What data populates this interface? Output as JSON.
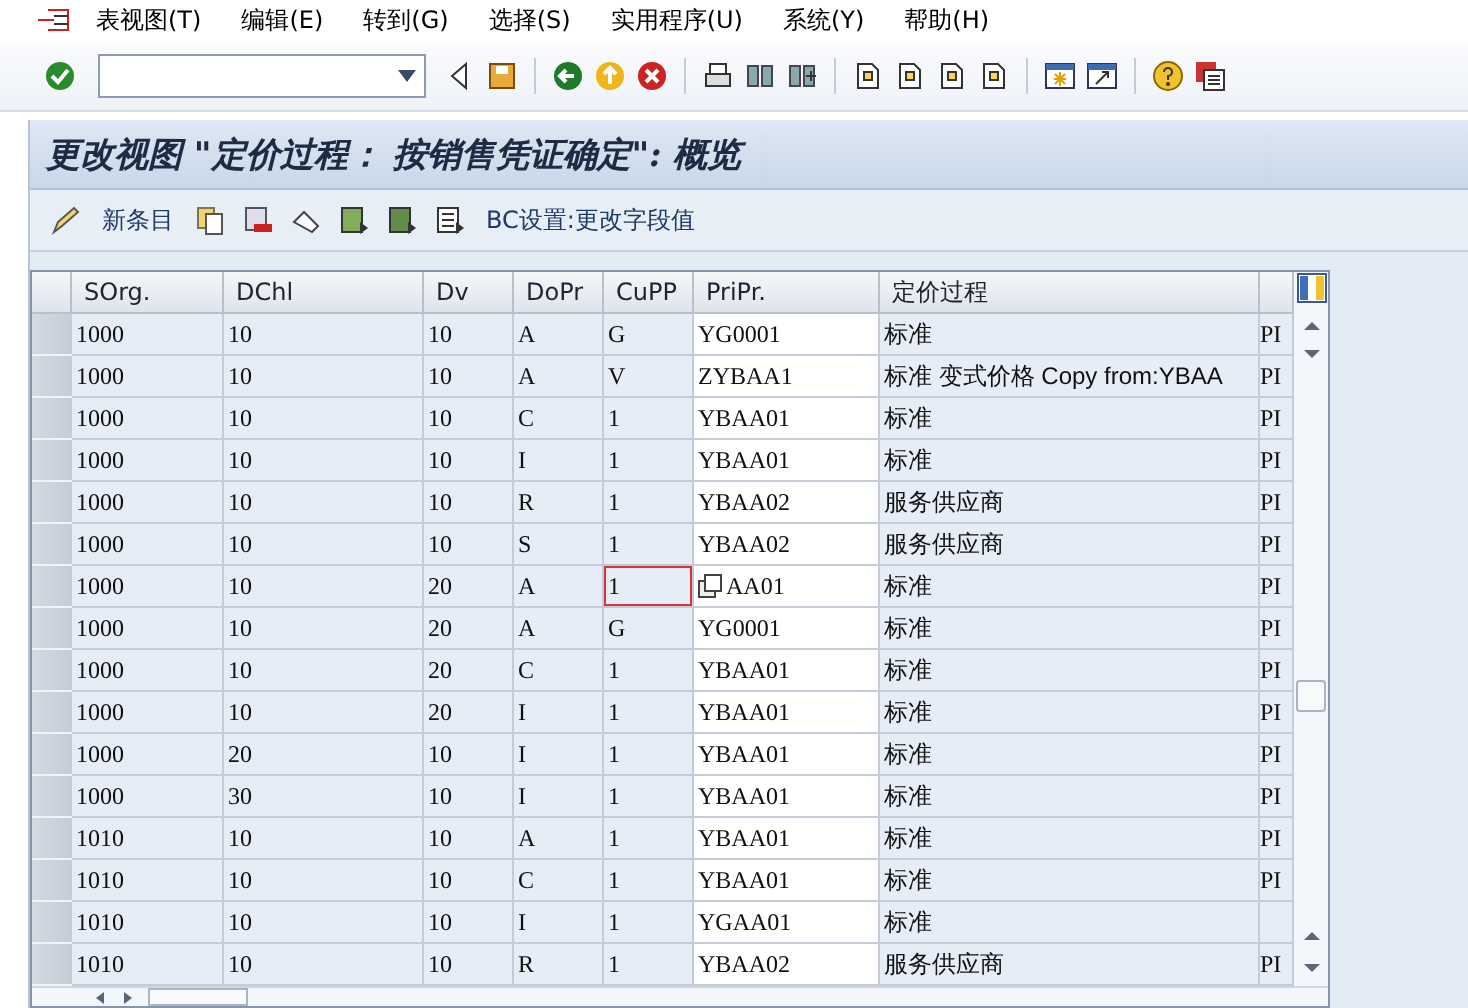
{
  "menu": [
    {
      "label": "表视图(T)"
    },
    {
      "label": "编辑(E)"
    },
    {
      "label": "转到(G)"
    },
    {
      "label": "选择(S)"
    },
    {
      "label": "实用程序(U)"
    },
    {
      "label": "系统(Y)"
    },
    {
      "label": "帮助(H)"
    }
  ],
  "title": "更改视图 \"定价过程： 按销售凭证确定\": 概览",
  "app_toolbar": [
    {
      "kind": "text",
      "label": "新条目"
    },
    {
      "kind": "text",
      "label": "BC设置:更改字段值"
    }
  ],
  "table": {
    "columns": [
      "SOrg.",
      "DChl",
      "Dv",
      "DoPr",
      "CuPP",
      "PriPr.",
      "定价过程"
    ],
    "rows": [
      {
        "cells": [
          "1000",
          "10",
          "10",
          "A",
          "G",
          "YG0001",
          "标准",
          "PI"
        ],
        "focused": false
      },
      {
        "cells": [
          "1000",
          "10",
          "10",
          "A",
          "V",
          "ZYBAA1",
          "标准 变式价格 Copy from:YBAA",
          "PI"
        ],
        "focused": false
      },
      {
        "cells": [
          "1000",
          "10",
          "10",
          "C",
          "1",
          "YBAA01",
          "标准",
          "PI"
        ],
        "focused": false
      },
      {
        "cells": [
          "1000",
          "10",
          "10",
          "I",
          "1",
          "YBAA01",
          "标准",
          "PI"
        ],
        "focused": false
      },
      {
        "cells": [
          "1000",
          "10",
          "10",
          "R",
          "1",
          "YBAA02",
          "服务供应商",
          "PI"
        ],
        "focused": false
      },
      {
        "cells": [
          "1000",
          "10",
          "10",
          "S",
          "1",
          "YBAA02",
          "服务供应商",
          "PI"
        ],
        "focused": false
      },
      {
        "cells": [
          "1000",
          "10",
          "20",
          "A",
          "1",
          "AA01",
          "标准",
          "PI"
        ],
        "focused": true
      },
      {
        "cells": [
          "1000",
          "10",
          "20",
          "A",
          "G",
          "YG0001",
          "标准",
          "PI"
        ],
        "focused": false
      },
      {
        "cells": [
          "1000",
          "10",
          "20",
          "C",
          "1",
          "YBAA01",
          "标准",
          "PI"
        ],
        "focused": false
      },
      {
        "cells": [
          "1000",
          "10",
          "20",
          "I",
          "1",
          "YBAA01",
          "标准",
          "PI"
        ],
        "focused": false
      },
      {
        "cells": [
          "1000",
          "20",
          "10",
          "I",
          "1",
          "YBAA01",
          "标准",
          "PI"
        ],
        "focused": false
      },
      {
        "cells": [
          "1000",
          "30",
          "10",
          "I",
          "1",
          "YBAA01",
          "标准",
          "PI"
        ],
        "focused": false
      },
      {
        "cells": [
          "1010",
          "10",
          "10",
          "A",
          "1",
          "YBAA01",
          "标准",
          "PI"
        ],
        "focused": false
      },
      {
        "cells": [
          "1010",
          "10",
          "10",
          "C",
          "1",
          "YBAA01",
          "标准",
          "PI"
        ],
        "focused": false
      },
      {
        "cells": [
          "1010",
          "10",
          "10",
          "I",
          "1",
          "YGAA01",
          "标准",
          ""
        ],
        "focused": false
      },
      {
        "cells": [
          "1010",
          "10",
          "10",
          "R",
          "1",
          "YBAA02",
          "服务供应商",
          "PI"
        ],
        "focused": false
      }
    ]
  }
}
